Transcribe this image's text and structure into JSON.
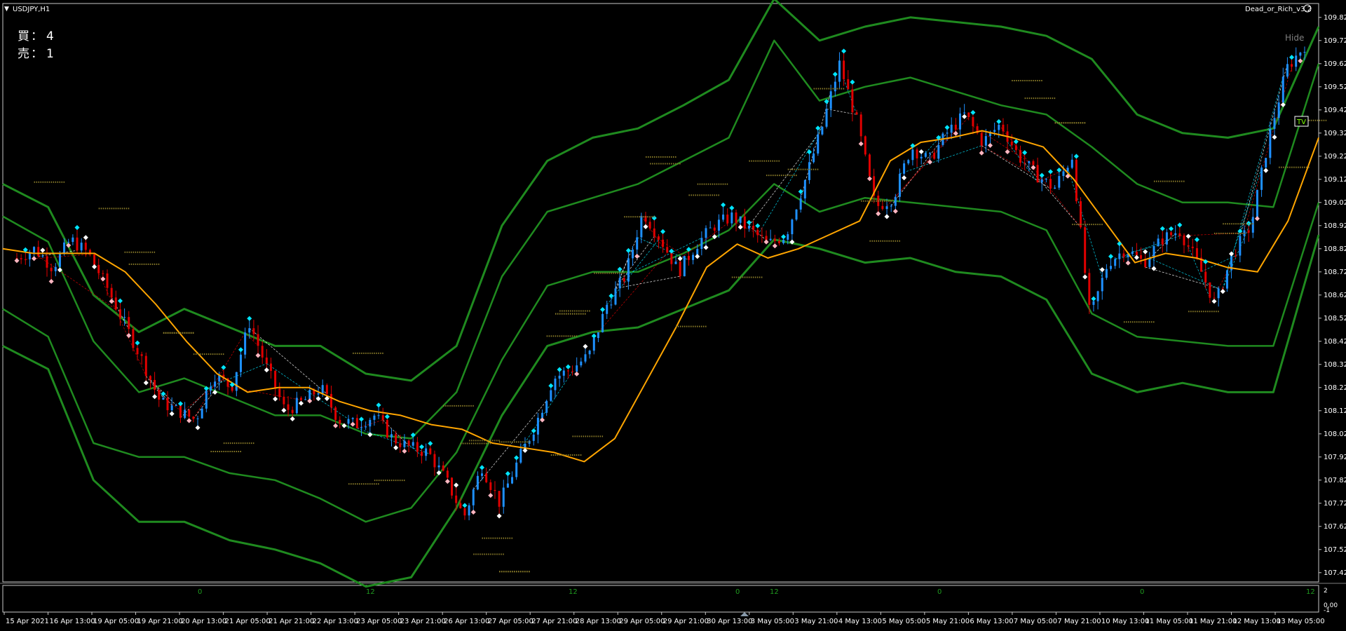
{
  "window": {
    "title": "USDJPY,H1",
    "indicator_name": "Dead_or_Rich_v3.2",
    "hide_label": "Hide",
    "tv_badge": "TV"
  },
  "signals": {
    "buy_label": "買",
    "buy_count": "4",
    "sell_label": "売",
    "sell_count": "1",
    "separator": "："
  },
  "colors": {
    "background": "#000000",
    "frame": "#c8c8c8",
    "text": "#ffffff",
    "band": "#1f8a1f",
    "ma": "#ffa500",
    "bull": "#1e90ff",
    "bear": "#e00000",
    "cyan_marker": "#00e5ff",
    "subwindow_text": "#1f9a1f"
  },
  "chart_data": {
    "type": "line",
    "symbol": "USDJPY",
    "timeframe": "H1",
    "ylim": [
      107.38,
      109.88
    ],
    "price_ticks": [
      "109.820",
      "109.720",
      "109.620",
      "109.520",
      "109.420",
      "109.320",
      "109.220",
      "109.120",
      "109.020",
      "108.920",
      "108.820",
      "108.720",
      "108.620",
      "108.520",
      "108.420",
      "108.320",
      "108.220",
      "108.120",
      "108.020",
      "107.920",
      "107.820",
      "107.720",
      "107.620",
      "107.520",
      "107.420"
    ],
    "time_ticks": [
      "15 Apr 2021",
      "16 Apr 13:00",
      "19 Apr 05:00",
      "19 Apr 21:00",
      "20 Apr 13:00",
      "21 Apr 05:00",
      "21 Apr 21:00",
      "22 Apr 13:00",
      "23 Apr 05:00",
      "23 Apr 21:00",
      "26 Apr 13:00",
      "27 Apr 05:00",
      "27 Apr 21:00",
      "28 Apr 13:00",
      "29 Apr 05:00",
      "29 Apr 21:00",
      "30 Apr 13:00",
      "3 May 05:00",
      "3 May 21:00",
      "4 May 13:00",
      "5 May 05:00",
      "5 May 21:00",
      "6 May 13:00",
      "7 May 05:00",
      "7 May 21:00",
      "10 May 13:00",
      "11 May 05:00",
      "11 May 21:00",
      "12 May 13:00",
      "13 May 05:00"
    ],
    "close_prices": [
      108.78,
      108.82,
      108.74,
      108.86,
      108.8,
      108.66,
      108.5,
      108.34,
      108.16,
      108.12,
      108.08,
      108.28,
      108.22,
      108.5,
      108.3,
      108.12,
      108.16,
      108.22,
      108.08,
      108.06,
      108.1,
      108.0,
      107.96,
      107.94,
      107.82,
      107.66,
      107.88,
      107.72,
      107.9,
      108.06,
      108.26,
      108.3,
      108.36,
      108.58,
      108.7,
      108.98,
      108.86,
      108.72,
      108.84,
      108.92,
      108.96,
      108.9,
      108.84,
      108.88,
      109.1,
      109.34,
      109.62,
      109.36,
      109.0,
      109.04,
      109.26,
      109.2,
      109.32,
      109.4,
      109.28,
      109.36,
      109.22,
      109.14,
      109.08,
      109.22,
      108.52,
      108.76,
      108.82,
      108.76,
      108.86,
      108.9,
      108.76,
      108.58,
      108.8,
      108.92,
      109.3,
      109.6,
      109.7
    ],
    "ma_values": [
      108.82,
      108.8,
      108.8,
      108.8,
      108.72,
      108.58,
      108.42,
      108.28,
      108.2,
      108.22,
      108.22,
      108.16,
      108.12,
      108.1,
      108.06,
      108.04,
      107.98,
      107.96,
      107.94,
      107.9,
      108.0,
      108.24,
      108.48,
      108.74,
      108.84,
      108.78,
      108.82,
      108.88,
      108.94,
      109.2,
      109.28,
      109.3,
      109.33,
      109.3,
      109.26,
      109.12,
      108.94,
      108.76,
      108.8,
      108.78,
      108.74,
      108.72,
      108.94,
      109.3
    ],
    "band_levels": {
      "outer_upper": [
        109.1,
        109.0,
        108.62,
        108.46,
        108.56,
        108.48,
        108.4,
        108.4,
        108.28,
        108.25,
        108.4,
        108.92,
        109.2,
        109.3,
        109.34,
        109.44,
        109.55,
        109.9,
        109.72,
        109.78,
        109.82,
        109.8,
        109.78,
        109.74,
        109.64,
        109.4,
        109.32,
        109.3,
        109.34,
        109.78
      ],
      "inner_upper": [
        108.96,
        108.85,
        108.42,
        108.2,
        108.26,
        108.18,
        108.1,
        108.1,
        108.02,
        108.0,
        108.2,
        108.7,
        108.98,
        109.04,
        109.1,
        109.2,
        109.3,
        109.72,
        109.46,
        109.52,
        109.56,
        109.5,
        109.44,
        109.4,
        109.26,
        109.1,
        109.02,
        109.02,
        109.0,
        109.62
      ],
      "inner_lower": [
        108.56,
        108.44,
        107.98,
        107.92,
        107.92,
        107.85,
        107.82,
        107.74,
        107.64,
        107.7,
        107.94,
        108.34,
        108.66,
        108.72,
        108.72,
        108.8,
        108.9,
        109.1,
        108.98,
        109.04,
        109.02,
        109.0,
        108.98,
        108.9,
        108.54,
        108.44,
        108.42,
        108.4,
        108.4,
        109.02
      ],
      "outer_lower": [
        108.4,
        108.3,
        107.82,
        107.64,
        107.64,
        107.56,
        107.52,
        107.46,
        107.36,
        107.4,
        107.7,
        108.1,
        108.4,
        108.46,
        108.48,
        108.56,
        108.64,
        108.86,
        108.82,
        108.76,
        108.78,
        108.72,
        108.7,
        108.6,
        108.28,
        108.2,
        108.24,
        108.2,
        108.2,
        108.88
      ]
    }
  },
  "subwindow": {
    "left_axis_labels": [
      "0",
      "12",
      "12",
      "0",
      "12",
      "0",
      "0",
      "12"
    ],
    "right_axis_labels": [
      "2",
      "0,00",
      "-1"
    ]
  }
}
